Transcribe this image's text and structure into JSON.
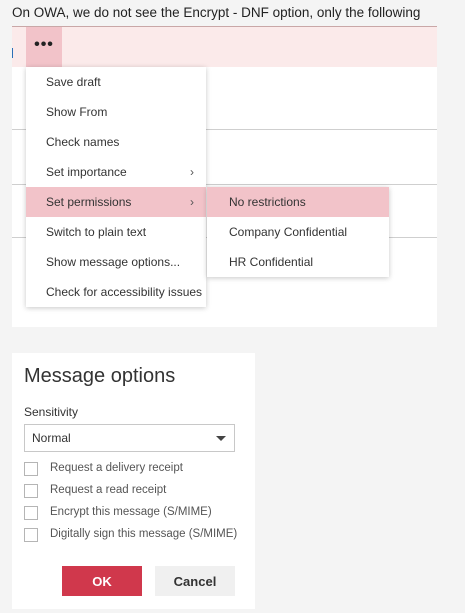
{
  "caption": "On OWA, we do not see the Encrypt - DNF option, only the following",
  "toolbar": {
    "more_icon": "ellipsis-icon",
    "more_glyph": "•••"
  },
  "menu": {
    "items": [
      {
        "label": "Save draft",
        "submenu": false
      },
      {
        "label": "Show From",
        "submenu": false
      },
      {
        "label": "Check names",
        "submenu": false
      },
      {
        "label": "Set importance",
        "submenu": true
      },
      {
        "label": "Set permissions",
        "submenu": true,
        "active": true
      },
      {
        "label": "Switch to plain text",
        "submenu": false
      },
      {
        "label": "Show message options...",
        "submenu": false
      },
      {
        "label": "Check for accessibility issues",
        "submenu": false
      }
    ],
    "chevron_glyph": "›"
  },
  "submenu": {
    "items": [
      {
        "label": "No restrictions",
        "active": true
      },
      {
        "label": "Company Confidential"
      },
      {
        "label": "HR Confidential"
      }
    ]
  },
  "dialog": {
    "title": "Message options",
    "sensitivity_label": "Sensitivity",
    "sensitivity_value": "Normal",
    "checkboxes": [
      {
        "label": "Request a delivery receipt",
        "checked": false
      },
      {
        "label": "Request a read receipt",
        "checked": false
      },
      {
        "label": "Encrypt this message (S/MIME)",
        "checked": false
      },
      {
        "label": "Digitally sign this message (S/MIME)",
        "checked": false
      }
    ],
    "ok_label": "OK",
    "cancel_label": "Cancel"
  },
  "colors": {
    "accent": "#d0384c",
    "highlight": "#f2c3c9",
    "toolbar_bg": "#fbeaea"
  }
}
